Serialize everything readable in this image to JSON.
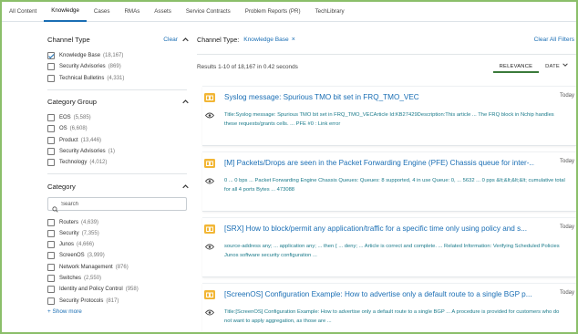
{
  "tabs": [
    {
      "label": "All Content",
      "active": false
    },
    {
      "label": "Knowledge",
      "active": true
    },
    {
      "label": "Cases",
      "active": false
    },
    {
      "label": "RMAs",
      "active": false
    },
    {
      "label": "Assets",
      "active": false
    },
    {
      "label": "Service Contracts",
      "active": false
    },
    {
      "label": "Problem Reports (PR)",
      "active": false
    },
    {
      "label": "TechLibrary",
      "active": false
    }
  ],
  "facets": {
    "channel_type": {
      "title": "Channel Type",
      "clear_label": "Clear",
      "options": [
        {
          "label": "Knowledge Base",
          "count": "(18,167)",
          "checked": true
        },
        {
          "label": "Security Advisories",
          "count": "(869)",
          "checked": false
        },
        {
          "label": "Technical Bulletins",
          "count": "(4,331)",
          "checked": false
        }
      ]
    },
    "category_group": {
      "title": "Category Group",
      "options": [
        {
          "label": "EOS",
          "count": "(5,585)",
          "checked": false
        },
        {
          "label": "OS",
          "count": "(6,608)",
          "checked": false
        },
        {
          "label": "Product",
          "count": "(13,446)",
          "checked": false
        },
        {
          "label": "Security Advisories",
          "count": "(1)",
          "checked": false
        },
        {
          "label": "Technology",
          "count": "(4,012)",
          "checked": false
        }
      ]
    },
    "category": {
      "title": "Category",
      "search_placeholder": "Search",
      "options": [
        {
          "label": "Routers",
          "count": "(4,639)",
          "checked": false
        },
        {
          "label": "Security",
          "count": "(7,355)",
          "checked": false
        },
        {
          "label": "Junos",
          "count": "(4,666)",
          "checked": false
        },
        {
          "label": "ScreenOS",
          "count": "(3,999)",
          "checked": false
        },
        {
          "label": "Network Management",
          "count": "(876)",
          "checked": false
        },
        {
          "label": "Switches",
          "count": "(2,550)",
          "checked": false
        },
        {
          "label": "Identity and Policy Control",
          "count": "(958)",
          "checked": false
        },
        {
          "label": "Security Protocols",
          "count": "(817)",
          "checked": false
        }
      ],
      "show_more": "+ Show more"
    }
  },
  "filter_bar": {
    "label": "Channel Type:",
    "chip": "Knowledge Base",
    "chip_remove": "×",
    "clear_all": "Clear All Filters"
  },
  "results_summary": "Results 1-10 of 18,167 in 0.42 seconds",
  "sort": {
    "relevance": "RELEVANCE",
    "date": "DATE"
  },
  "results": [
    {
      "title": "Syslog message: Spurious TMO bit set in FRQ_TMO_VEC",
      "date": "Today",
      "snippet": "Title:Syslog message: Spurious TMO bit set in FRQ_TMO_VECArticle Id:KB27429Description:This article ... The FRQ block in Nchip handles these requests/grants cells. ... PFE #0 : Link error"
    },
    {
      "title": "[M] Packets/Drops are seen in the Packet Forwarding Engine (PFE) Chassis queue for inter-...",
      "date": "Today",
      "snippet": "0 ... 0 bps ... Packet Forwarding Engine Chassis Queues: Queues: 8 supported, 4 in use Queue: 0, ... 5632 ... 0 pps &lt;&lt;&lt;&lt; cumulative total for all 4 ports Bytes ... 473088"
    },
    {
      "title": "[SRX] How to block/permit any application/traffic for a specific time only using policy and s...",
      "date": "Today",
      "snippet": "source-address any; ... application any; ... then { ... deny; ... Article is correct and complete. ... Related Information: Verifying Scheduled Policies Junos software security configuration ..."
    },
    {
      "title": "[ScreenOS] Configuration Example: How to advertise only a default route to a single BGP p...",
      "date": "Today",
      "snippet": "Title:[ScreenOS] Configuration Example: How to advertise only a default route to a single BGP ... A procedure is provided for customers who do not want to apply aggregation, as those are ..."
    }
  ],
  "colors": {
    "accent": "#1a6eb4",
    "snippet": "#1a7a8a",
    "kb_icon": "#f2b635",
    "frame": "#8bbf6a"
  },
  "icons": {
    "kb": "knowledge-base-icon",
    "eye": "preview-eye-icon",
    "search": "search-icon",
    "collapse": "chevron-up-icon",
    "sort": "chevron-down-icon"
  }
}
